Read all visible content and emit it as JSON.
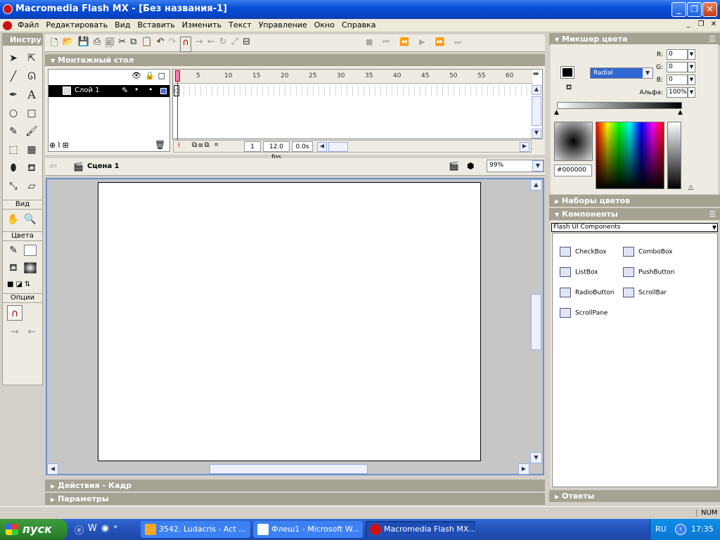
{
  "window": {
    "title": "Macromedia Flash MX - [Без названия-1]"
  },
  "menu": [
    "Файл",
    "Редактировать",
    "Вид",
    "Вставить",
    "Изменить",
    "Текст",
    "Управление",
    "Окно",
    "Справка"
  ],
  "tools": {
    "title": "Инстру",
    "view_label": "Вид",
    "colors_label": "Цвета",
    "options_label": "Опции"
  },
  "timeline": {
    "title": "Монтажный стол",
    "layer_name": "Слой 1",
    "frame_numbers": [
      "1",
      "5",
      "10",
      "15",
      "20",
      "25",
      "30",
      "35",
      "40",
      "45",
      "50",
      "55",
      "60"
    ],
    "current_frame": "1",
    "fps": "12.0 fps",
    "time": "0.0s"
  },
  "scene": {
    "name": "Сцена 1",
    "zoom": "99%"
  },
  "panels": {
    "mixer_title": "Микшер цвета",
    "mixer": {
      "r_label": "R:",
      "g_label": "G:",
      "b_label": "B:",
      "alpha_label": "Альфа:",
      "r": "0",
      "g": "0",
      "b": "0",
      "alpha": "100%",
      "fill_type": "Radial",
      "hex": "#000000"
    },
    "swatches_title": "Наборы цветов",
    "components_title": "Компоненты",
    "components_set": "Flash UI Components",
    "components": [
      "CheckBox",
      "ComboBox",
      "ListBox",
      "PushButton",
      "RadioButton",
      "ScrollBar",
      "ScrollPane"
    ],
    "answers_title": "Ответы",
    "actions_title": "Действия - Кадр",
    "params_title": "Параметры"
  },
  "status": {
    "num": "NUM"
  },
  "taskbar": {
    "start": "пуск",
    "tasks": [
      "3542. Ludacris - Act ...",
      "Флеш1 - Microsoft W...",
      "Macromedia Flash MX..."
    ],
    "lang": "RU",
    "clock": "17:35"
  }
}
